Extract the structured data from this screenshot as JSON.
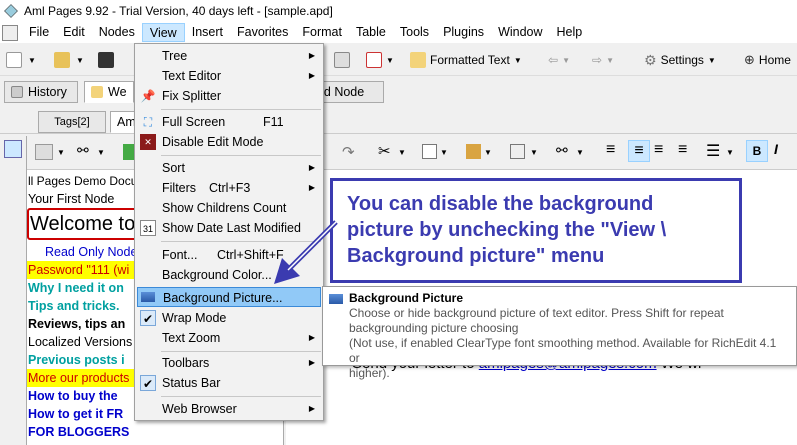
{
  "window": {
    "title": "Aml Pages 9.92 - Trial Version, 40 days left - [sample.apd]"
  },
  "menubar": [
    "File",
    "Edit",
    "Nodes",
    "View",
    "Insert",
    "Favorites",
    "Format",
    "Table",
    "Tools",
    "Plugins",
    "Window",
    "Help"
  ],
  "toolbar": {
    "formatted_text": "Formatted Text",
    "settings": "Settings",
    "home": "Home"
  },
  "tabs": {
    "history": "History",
    "tab_we": "We",
    "tab_ned_node": "ned Node",
    "tags": "Tags[2]",
    "tab_am": "Am"
  },
  "view_menu": {
    "tree": "Tree",
    "text_editor": "Text Editor",
    "fix_splitter": "Fix Splitter",
    "full_screen": "Full Screen",
    "full_screen_sc": "F11",
    "disable_edit_mode": "Disable Edit Mode",
    "sort": "Sort",
    "filters": "Filters",
    "filters_sc": "Ctrl+F3",
    "show_children_count": "Show Childrens Count",
    "show_date_last_modified": "Show Date Last Modified",
    "font": "Font...",
    "font_sc": "Ctrl+Shift+F",
    "background_color": "Background Color...",
    "background_picture": "Background Picture...",
    "wrap_mode": "Wrap Mode",
    "text_zoom": "Text Zoom",
    "toolbars": "Toolbars",
    "status_bar": "Status Bar",
    "web_browser": "Web Browser"
  },
  "tree": [
    {
      "text": "ll Pages Demo Docu",
      "color": "#000000",
      "bold": false,
      "bg": ""
    },
    {
      "text": "Your First Node",
      "color": "#000000",
      "bold": false,
      "bg": ""
    },
    {
      "text": "Welcome to",
      "color": "#000000",
      "bold": false,
      "bg": ""
    },
    {
      "text": "Read Only Node",
      "color": "#0000cc",
      "bold": false,
      "bg": ""
    },
    {
      "text": "Password \"111 (wi",
      "color": "#cc0000",
      "bold": false,
      "bg": "#ffff00"
    },
    {
      "text": "Why I need it on",
      "color": "#00a0a0",
      "bold": true,
      "bg": ""
    },
    {
      "text": "Tips and tricks.",
      "color": "#00a0a0",
      "bold": true,
      "bg": ""
    },
    {
      "text": "Reviews, tips an",
      "color": "#000000",
      "bold": true,
      "bg": ""
    },
    {
      "text": "Localized Versions",
      "color": "#000000",
      "bold": false,
      "bg": ""
    },
    {
      "text": "Previous posts i",
      "color": "#00a0a0",
      "bold": true,
      "bg": ""
    },
    {
      "text": "More our products",
      "color": "#cc0000",
      "bold": false,
      "bg": "#ffff00"
    },
    {
      "text": "How to buy the",
      "color": "#0000cc",
      "bold": true,
      "bg": ""
    },
    {
      "text": "How to get it FR",
      "color": "#0000cc",
      "bold": true,
      "bg": ""
    },
    {
      "text": "FOR BLOGGERS",
      "color": "#0000cc",
      "bold": true,
      "bg": ""
    }
  ],
  "callout": {
    "text": "You can disable the background picture by unchecking the \"View \\ Background picture\" menu"
  },
  "tooltip": {
    "title": "Background Picture",
    "desc1": "Choose or hide background picture of text editor. Press Shift for repeat",
    "desc2": "backgrounding picture choosing",
    "desc3": "(Not use, if enabled ClearType font smoothing method. Available for RichEdit 4.1 or",
    "desc4": "higher)."
  },
  "editor": {
    "line": "Send your letter to",
    "email": "amlpages@amlpages.com",
    "tail": "We wi"
  },
  "colors": {
    "callout": "#3b3bb0",
    "menu_highlight": "#91c9f7",
    "active_menu": "#cce8ff"
  }
}
